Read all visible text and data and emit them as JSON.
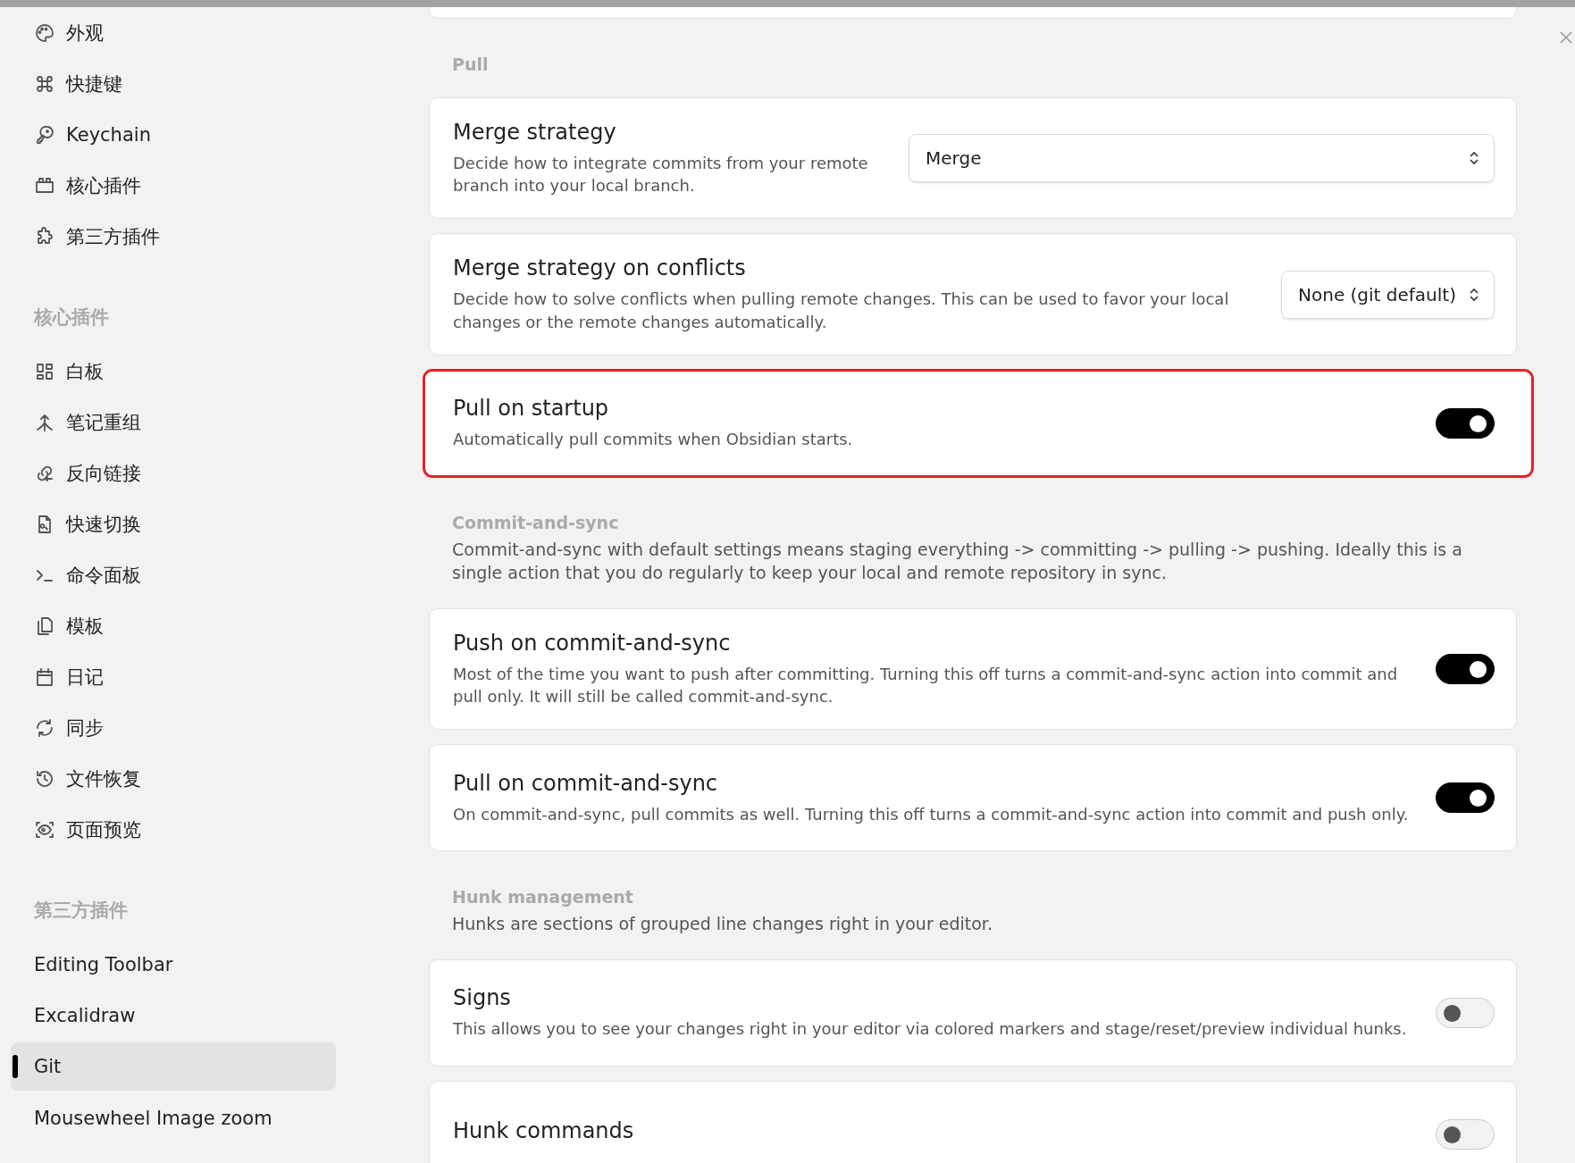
{
  "sidebar": {
    "groups": [
      {
        "items": [
          {
            "label": "外观",
            "selected": false
          },
          {
            "label": "快捷键",
            "selected": false
          },
          {
            "label": "Keychain",
            "selected": false
          },
          {
            "label": "核心插件",
            "selected": false
          },
          {
            "label": "第三方插件",
            "selected": false
          }
        ]
      },
      {
        "heading": "核心插件",
        "items": [
          {
            "label": "白板",
            "selected": false
          },
          {
            "label": "笔记重组",
            "selected": false
          },
          {
            "label": "反向链接",
            "selected": false
          },
          {
            "label": "快速切换",
            "selected": false
          },
          {
            "label": "命令面板",
            "selected": false
          },
          {
            "label": "模板",
            "selected": false
          },
          {
            "label": "日记",
            "selected": false
          },
          {
            "label": "同步",
            "selected": false
          },
          {
            "label": "文件恢复",
            "selected": false
          },
          {
            "label": "页面预览",
            "selected": false
          }
        ]
      },
      {
        "heading": "第三方插件",
        "items": [
          {
            "label": "Editing Toolbar",
            "selected": false
          },
          {
            "label": "Excalidraw",
            "selected": false
          },
          {
            "label": "Git",
            "selected": true
          },
          {
            "label": "Mousewheel Image zoom",
            "selected": false
          }
        ]
      }
    ]
  },
  "sections": [
    {
      "heading": "Pull",
      "settings": [
        {
          "kind": "dropdown",
          "name": "Merge strategy",
          "description": "Decide how to integrate commits from your remote branch into your local branch.",
          "value": "Merge",
          "wide": true
        },
        {
          "kind": "dropdown",
          "name": "Merge strategy on conflicts",
          "description": "Decide how to solve conflicts when pulling remote changes. This can be used to favor your local changes or the remote changes automatically.",
          "value": "None (git default)",
          "wide": false
        },
        {
          "kind": "toggle",
          "name": "Pull on startup",
          "description": "Automatically pull commits when Obsidian starts.",
          "on": true,
          "highlighted": true
        }
      ]
    },
    {
      "heading": "Commit-and-sync",
      "description": "Commit-and-sync with default settings means staging everything -> committing -> pulling -> pushing. Ideally this is a single action that you do regularly to keep your local and remote repository in sync.",
      "settings": [
        {
          "kind": "toggle",
          "name": "Push on commit-and-sync",
          "description": "Most of the time you want to push after committing. Turning this off turns a commit-and-sync action into commit and pull only. It will still be called commit-and-sync.",
          "on": true,
          "highlighted": false
        },
        {
          "kind": "toggle",
          "name": "Pull on commit-and-sync",
          "description": "On commit-and-sync, pull commits as well. Turning this off turns a commit-and-sync action into commit and push only.",
          "on": true,
          "highlighted": false
        }
      ]
    },
    {
      "heading": "Hunk management",
      "description": "Hunks are sections of grouped line changes right in your editor.",
      "settings": [
        {
          "kind": "toggle",
          "name": "Signs",
          "description": "This allows you to see your changes right in your editor via colored markers and stage/reset/preview individual hunks.",
          "on": false,
          "highlighted": false
        },
        {
          "kind": "toggle",
          "name": "Hunk commands",
          "on": false,
          "highlighted": false
        }
      ]
    }
  ]
}
